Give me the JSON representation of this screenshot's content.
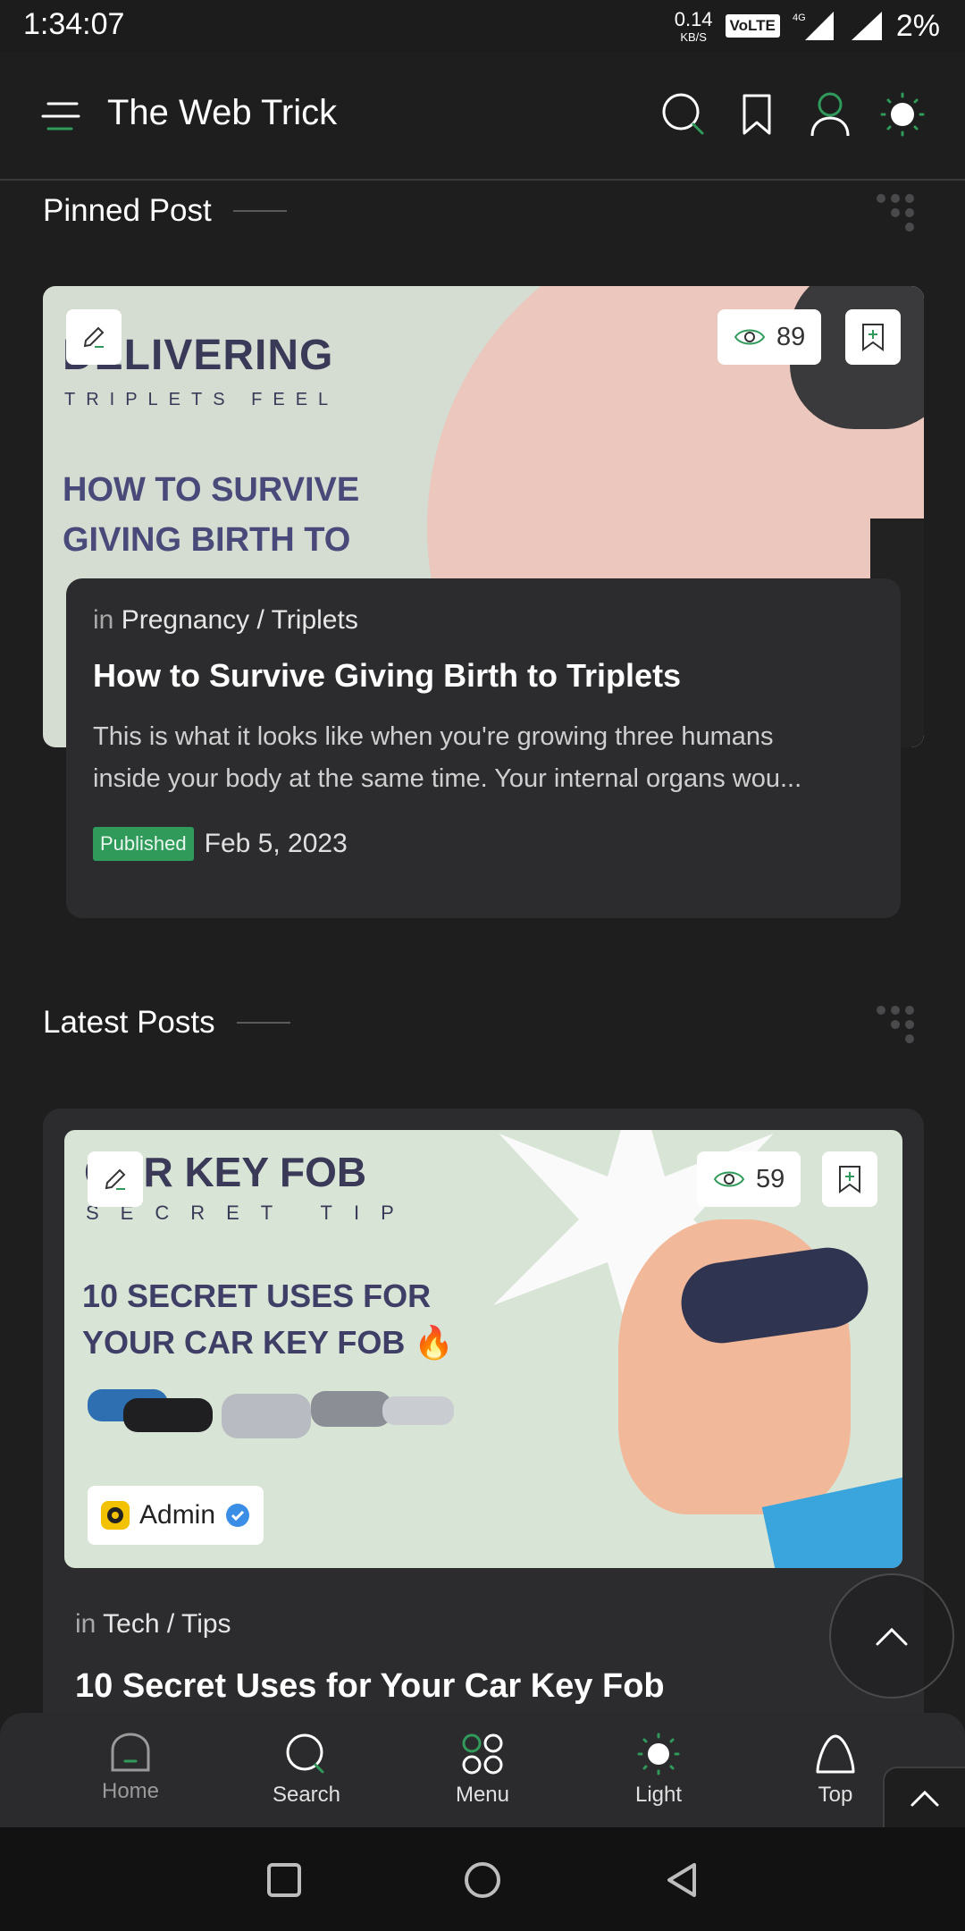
{
  "status_bar": {
    "time": "1:34:07",
    "net_speed_value": "0.14",
    "net_speed_unit": "KB/S",
    "volte": "VoLTE",
    "network": "4G",
    "battery": "2%"
  },
  "header": {
    "title": "The Web Trick",
    "icons": [
      "menu-icon",
      "search-icon",
      "bookmark-icon",
      "user-icon",
      "theme-toggle-icon"
    ]
  },
  "pinned": {
    "section_title": "Pinned Post",
    "image_text": {
      "line1": "DELIVERING",
      "line2": "TRIPLETS FEEL",
      "line3a": "HOW TO SURVIVE",
      "line3b": "GIVING BIRTH TO"
    },
    "views": "89",
    "category_prefix": "in",
    "category": "Pregnancy / Triplets",
    "title": "How to Survive Giving Birth to Triplets",
    "excerpt_line1": "This is what it looks like when you're growing three humans",
    "excerpt_line2": "inside your body at the same time. Your internal organs wou...",
    "status_badge": "Published",
    "date": "Feb 5, 2023"
  },
  "latest": {
    "section_title": "Latest Posts",
    "image_text": {
      "line1": "CAR KEY FOB",
      "line2": "SECRET TIP",
      "line3a": "10 SECRET USES FOR",
      "line3b": "YOUR CAR KEY FOB 🔥"
    },
    "views": "59",
    "author": "Admin",
    "category_prefix": "in",
    "category": "Tech / Tips",
    "title": "10 Secret Uses for Your Car Key Fob"
  },
  "bottom_nav": {
    "items": [
      {
        "label": "Home",
        "icon": "home-icon"
      },
      {
        "label": "Search",
        "icon": "search-icon"
      },
      {
        "label": "Menu",
        "icon": "menu-grid-icon"
      },
      {
        "label": "Light",
        "icon": "light-icon"
      },
      {
        "label": "Top",
        "icon": "top-icon"
      }
    ]
  },
  "colors": {
    "background": "#1e1e1f",
    "card": "#2c2c2e",
    "accent_green": "#2f9a5a"
  }
}
